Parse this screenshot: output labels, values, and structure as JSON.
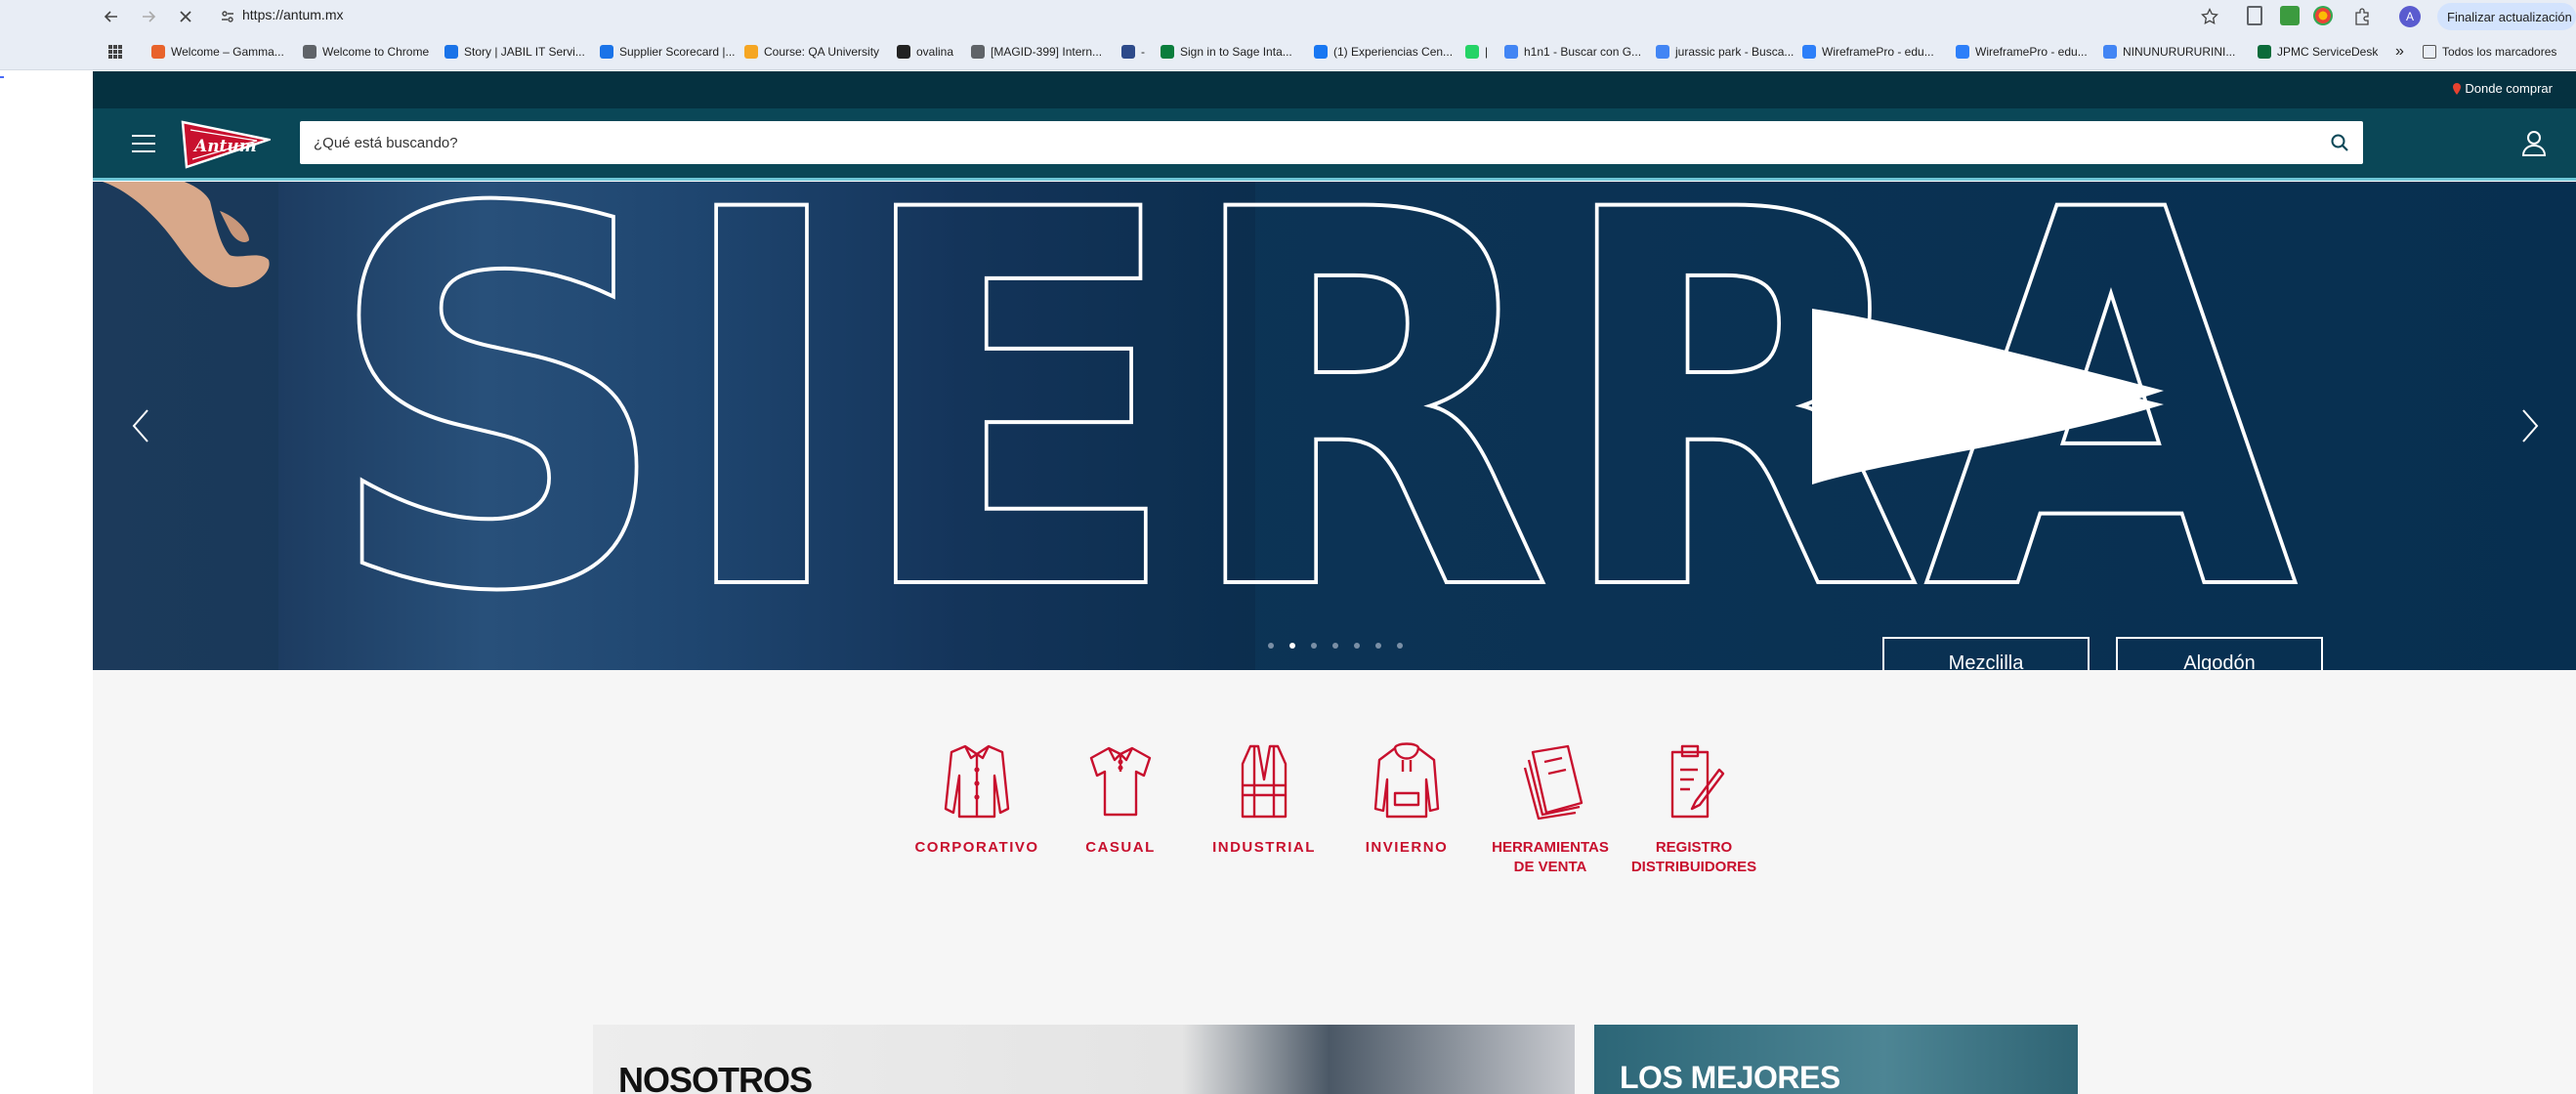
{
  "browser": {
    "url": "https://antum.mx",
    "update_label": "Finalizar actualización",
    "profile_initial": "A",
    "bookmarks": [
      {
        "label": "Welcome – Gamma...",
        "color": "#e8632b"
      },
      {
        "label": "Welcome to Chrome",
        "color": "#5f6368"
      },
      {
        "label": "Story | JABIL IT Servi...",
        "color": "#1a73e8"
      },
      {
        "label": "Supplier Scorecard |...",
        "color": "#1a73e8"
      },
      {
        "label": "Course: QA University",
        "color": "#f5a623"
      },
      {
        "label": "ovalina",
        "color": "#222222"
      },
      {
        "label": "[MAGID-399] Intern...",
        "color": "#5f6368"
      },
      {
        "label": "-",
        "color": "#2d4a8a"
      },
      {
        "label": "Sign in to Sage Inta...",
        "color": "#0a7d3c"
      },
      {
        "label": "(1) Experiencias Cen...",
        "color": "#1877f2"
      },
      {
        "label": "|",
        "color": "#25d366"
      },
      {
        "label": "h1n1 - Buscar con G...",
        "color": "#4285f4"
      },
      {
        "label": "jurassic park - Busca...",
        "color": "#4285f4"
      },
      {
        "label": "WireframePro - edu...",
        "color": "#2d7ff9"
      },
      {
        "label": "WireframePro - edu...",
        "color": "#2d7ff9"
      },
      {
        "label": "NINUNURURURINI...",
        "color": "#4285f4"
      },
      {
        "label": "JPMC ServiceDesk",
        "color": "#0b6b3a"
      }
    ],
    "more_label": "»",
    "all_bookmarks_label": "Todos los marcadores"
  },
  "site": {
    "top_link": "Donde comprar",
    "search_placeholder": "¿Qué está buscando?",
    "logo_text": "Antum",
    "hero": {
      "word": "SIERRA",
      "tags": [
        "Mezclilla",
        "Algodón"
      ],
      "slide_count": 7,
      "active_slide": 2
    },
    "categories": [
      {
        "icon": "shirt-icon",
        "label": "CORPORATIVO"
      },
      {
        "icon": "polo-icon",
        "label": "CASUAL"
      },
      {
        "icon": "vest-icon",
        "label": "INDUSTRIAL"
      },
      {
        "icon": "hoodie-icon",
        "label": "INVIERNO"
      },
      {
        "icon": "catalog-icon",
        "label": "HERRAMIENTAS DE VENTA"
      },
      {
        "icon": "clipboard-icon",
        "label": "REGISTRO DISTRIBUIDORES"
      }
    ],
    "cards": {
      "nosotros": "NOSOTROS",
      "mejores": "LOS MEJORES"
    },
    "colors": {
      "accent_red": "#c8102e",
      "header_teal": "#0a4757",
      "top_strip": "#053140"
    }
  }
}
